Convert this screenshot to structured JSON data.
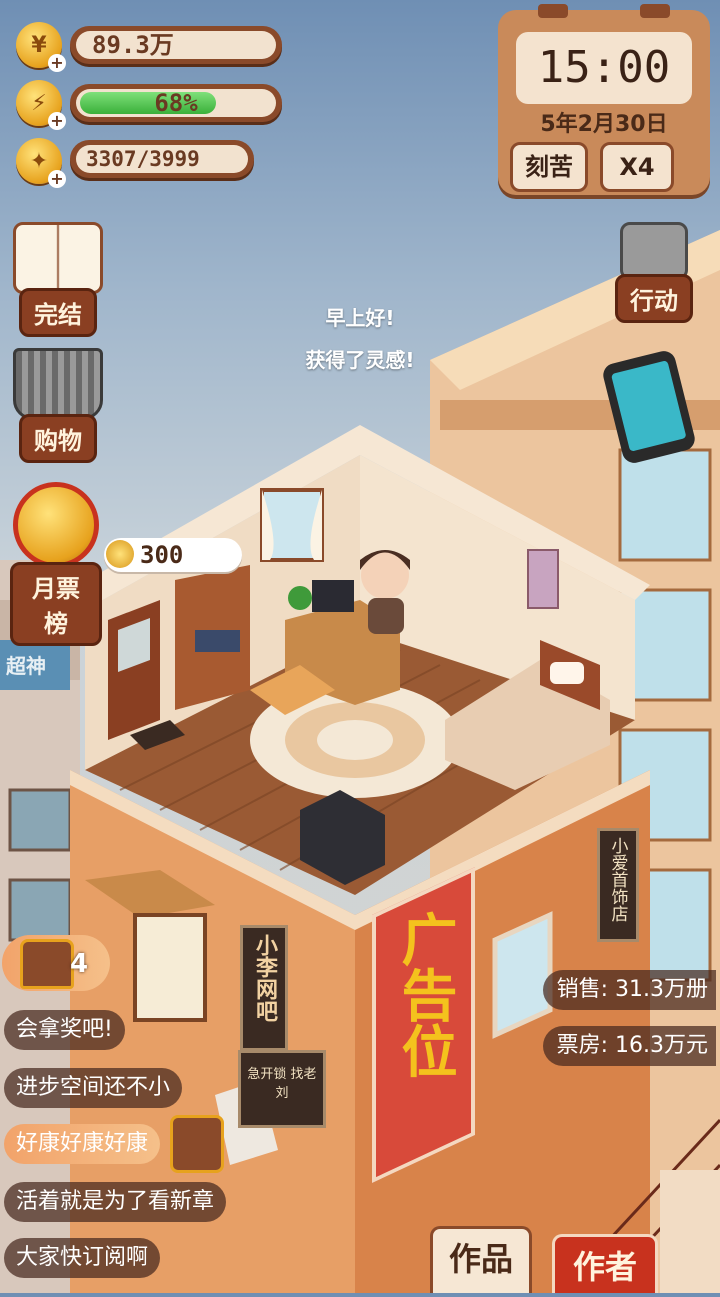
{
  "stats": {
    "coins": "89.3万",
    "energy_percent": "68%",
    "energy_fraction": 0.68,
    "inspiration": "3307/3999"
  },
  "clock": {
    "time": "15:00",
    "date": "5年2月30日",
    "mode_button": "刻苦",
    "speed_button": "X4"
  },
  "left_menu": {
    "complete": "完结",
    "shopping": "购物",
    "monthly_ticket": "月票榜"
  },
  "right_menu": {
    "action": "行动"
  },
  "dialog": {
    "line1": "早上好!",
    "line2": "获得了灵感!"
  },
  "scene": {
    "coin_bubble": "300",
    "ad_banner": "广告位",
    "cafe_sign": "小李网吧",
    "shop_sign": "小爱首饰店",
    "cafe_plate": "急开锁 找老刘",
    "neighbor_sign": "超神"
  },
  "chest": {
    "count": "4"
  },
  "sales": {
    "sales_label": "销售: 31.3万册",
    "box_office_label": "票房: 16.3万元"
  },
  "chat": [
    "会拿奖吧!",
    "进步空间还不小",
    "好康好康好康",
    "活着就是为了看新章",
    "大家快订阅啊"
  ],
  "bottom_tabs": {
    "works": "作品",
    "author": "作者"
  },
  "colors": {
    "wood_dark": "#8a4a2a",
    "cream": "#f2e2cf",
    "building_orange": "#e59a60",
    "energy_green": "#3ab03a",
    "ad_red": "#d84a3a"
  }
}
